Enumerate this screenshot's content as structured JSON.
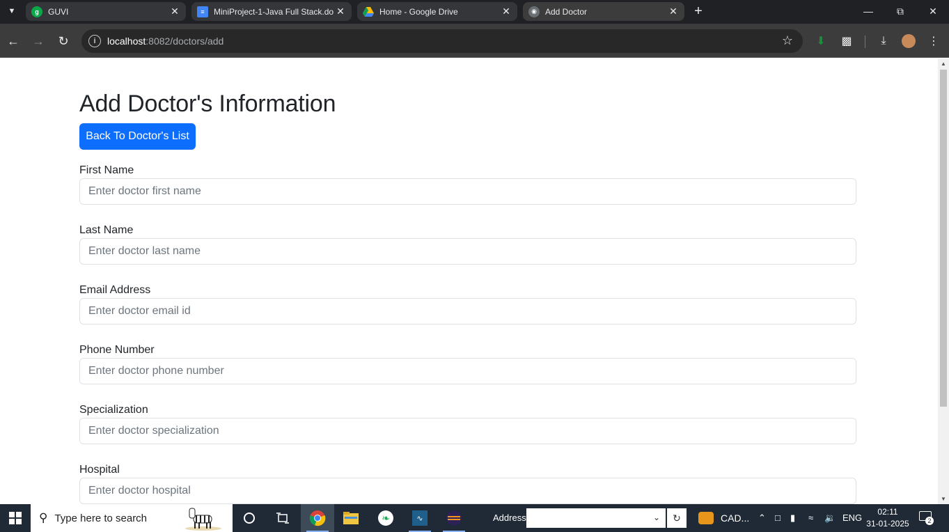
{
  "browser": {
    "tabs": [
      {
        "title": "GUVI",
        "icon": "guvi-icon",
        "color": "#0ba84a"
      },
      {
        "title": "MiniProject-1-Java Full Stack.do",
        "icon": "docs-icon",
        "color": "#4285f4"
      },
      {
        "title": "Home - Google Drive",
        "icon": "drive-icon",
        "color": "#fbbc04"
      },
      {
        "title": "Add Doctor",
        "icon": "globe-icon",
        "color": "#9aa0a6"
      }
    ],
    "address": {
      "host": "localhost",
      "path": ":8082/doctors/add"
    }
  },
  "page": {
    "title": "Add Doctor's Information",
    "back_button": "Back To Doctor's List",
    "accent_color": "#0d6efd",
    "fields": [
      {
        "label": "First Name",
        "placeholder": "Enter doctor first name"
      },
      {
        "label": "Last Name",
        "placeholder": "Enter doctor last name"
      },
      {
        "label": "Email Address",
        "placeholder": "Enter doctor email id"
      },
      {
        "label": "Phone Number",
        "placeholder": "Enter doctor phone number"
      },
      {
        "label": "Specialization",
        "placeholder": "Enter doctor specialization"
      },
      {
        "label": "Hospital",
        "placeholder": "Enter doctor hospital"
      }
    ]
  },
  "taskbar": {
    "search_placeholder": "Type here to search",
    "address_label": "Address",
    "tray_app": "CAD...",
    "language": "ENG",
    "time": "02:11",
    "date": "31-01-2025",
    "notifications": "2"
  }
}
